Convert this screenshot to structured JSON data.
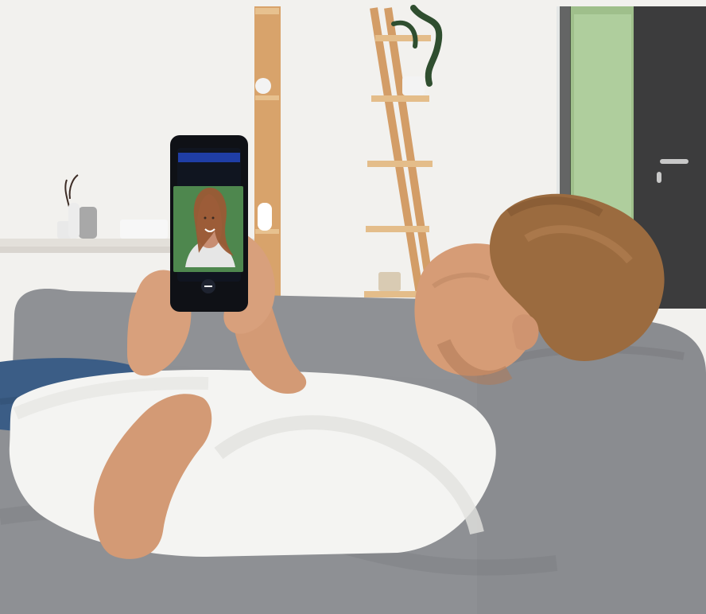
{
  "photo": {
    "phone": {
      "header_title": ""
    },
    "colors": {
      "wall": "#f2f1ee",
      "shelf_wood": "#d7a06a",
      "sofa": "#8e9094",
      "sofa_shadow": "#6f7175",
      "shirt": "#f4f4f2",
      "jeans": "#3b5d86",
      "skin": "#d59b77",
      "hair": "#9b6b3f",
      "phone_body": "#0f1116",
      "phone_header": "#1f3ea6"
    },
    "icons": {
      "phone_end_call": "end-call-icon"
    }
  }
}
